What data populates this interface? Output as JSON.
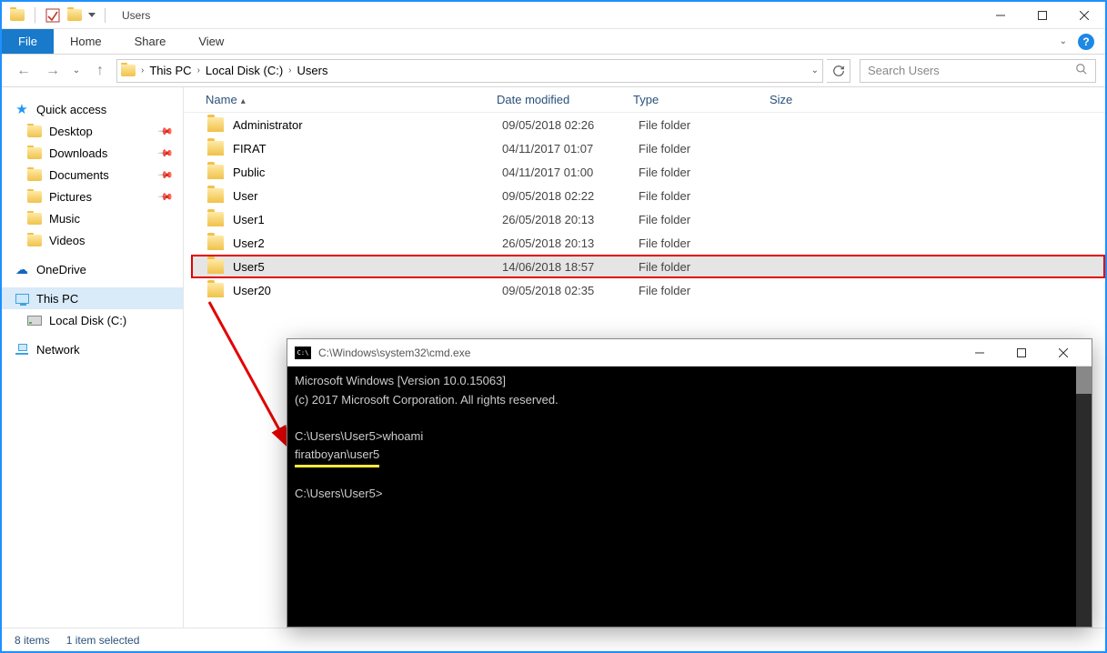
{
  "titlebar": {
    "title": "Users"
  },
  "ribbon": {
    "file": "File",
    "tabs": [
      "Home",
      "Share",
      "View"
    ]
  },
  "breadcrumb": {
    "items": [
      "This PC",
      "Local Disk (C:)",
      "Users"
    ]
  },
  "search": {
    "placeholder": "Search Users"
  },
  "sidebar": {
    "quickaccess": {
      "label": "Quick access"
    },
    "qa_items": [
      {
        "label": "Desktop"
      },
      {
        "label": "Downloads"
      },
      {
        "label": "Documents"
      },
      {
        "label": "Pictures"
      },
      {
        "label": "Music"
      },
      {
        "label": "Videos"
      }
    ],
    "onedrive": {
      "label": "OneDrive"
    },
    "thispc": {
      "label": "This PC"
    },
    "localdisk": {
      "label": "Local Disk (C:)"
    },
    "network": {
      "label": "Network"
    }
  },
  "columns": {
    "name": "Name",
    "date": "Date modified",
    "type": "Type",
    "size": "Size"
  },
  "rows": [
    {
      "name": "Administrator",
      "date": "09/05/2018 02:26",
      "type": "File folder"
    },
    {
      "name": "FIRAT",
      "date": "04/11/2017 01:07",
      "type": "File folder"
    },
    {
      "name": "Public",
      "date": "04/11/2017 01:00",
      "type": "File folder"
    },
    {
      "name": "User",
      "date": "09/05/2018 02:22",
      "type": "File folder"
    },
    {
      "name": "User1",
      "date": "26/05/2018 20:13",
      "type": "File folder"
    },
    {
      "name": "User2",
      "date": "26/05/2018 20:13",
      "type": "File folder"
    },
    {
      "name": "User5",
      "date": "14/06/2018 18:57",
      "type": "File folder",
      "highlight": true
    },
    {
      "name": "User20",
      "date": "09/05/2018 02:35",
      "type": "File folder"
    }
  ],
  "status": {
    "count": "8 items",
    "selected": "1 item selected"
  },
  "cmd": {
    "title": "C:\\Windows\\system32\\cmd.exe",
    "line1": "Microsoft Windows [Version 10.0.15063]",
    "line2": "(c) 2017 Microsoft Corporation. All rights reserved.",
    "prompt1a": "C:\\Users\\User5>",
    "prompt1b": "whoami",
    "result": "firatboyan\\user5",
    "prompt2": "C:\\Users\\User5>"
  }
}
